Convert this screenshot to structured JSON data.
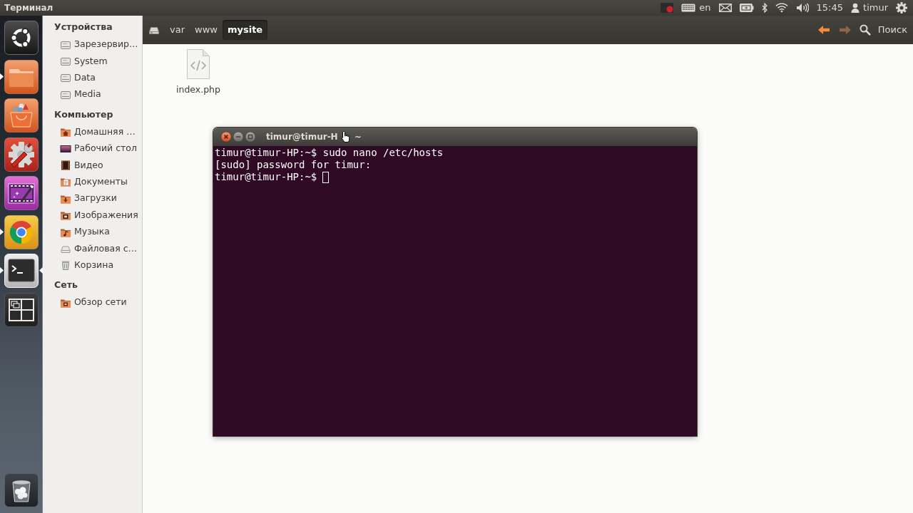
{
  "top_panel": {
    "app_title": "Терминал",
    "keyboard_layout": "en",
    "clock": "15:45",
    "user": "timur"
  },
  "launcher": {
    "items": [
      {
        "kind": "dash",
        "running": false,
        "focused": false
      },
      {
        "kind": "files",
        "running": true,
        "focused": false
      },
      {
        "kind": "software",
        "running": false,
        "focused": false
      },
      {
        "kind": "settings",
        "running": false,
        "focused": false
      },
      {
        "kind": "video_editor",
        "running": false,
        "focused": false
      },
      {
        "kind": "browser",
        "running": true,
        "focused": false
      },
      {
        "kind": "terminal",
        "running": true,
        "focused": true
      },
      {
        "kind": "workspaces",
        "running": false,
        "focused": false
      }
    ],
    "bottom_items": [
      {
        "kind": "trash",
        "running": false,
        "focused": false
      }
    ]
  },
  "sidebar": {
    "sections": [
      {
        "heading": "Устройства",
        "items": [
          {
            "label": "Зарезервир…",
            "kind": "drive",
            "selected": false
          },
          {
            "label": "System",
            "kind": "drive",
            "selected": false
          },
          {
            "label": "Data",
            "kind": "drive",
            "selected": false
          },
          {
            "label": "Media",
            "kind": "drive",
            "selected": false
          }
        ]
      },
      {
        "heading": "Компьютер",
        "items": [
          {
            "label": "Домашняя …",
            "kind": "home",
            "selected": false
          },
          {
            "label": "Рабочий стол",
            "kind": "desktop",
            "selected": false
          },
          {
            "label": "Видео",
            "kind": "videos",
            "selected": false
          },
          {
            "label": "Документы",
            "kind": "documents",
            "selected": false
          },
          {
            "label": "Загрузки",
            "kind": "downloads",
            "selected": false
          },
          {
            "label": "Изображения",
            "kind": "pictures",
            "selected": false
          },
          {
            "label": "Музыка",
            "kind": "music",
            "selected": false
          },
          {
            "label": "Файловая с…",
            "kind": "filesystem",
            "selected": false
          },
          {
            "label": "Корзина",
            "kind": "trash",
            "selected": false
          }
        ]
      },
      {
        "heading": "Сеть",
        "items": [
          {
            "label": "Обзор сети",
            "kind": "network",
            "selected": false
          }
        ]
      }
    ]
  },
  "toolbar": {
    "path": [
      {
        "kind": "root",
        "selected": false
      },
      {
        "kind": "folder",
        "label": "var",
        "selected": false
      },
      {
        "kind": "folder",
        "label": "www",
        "selected": false
      },
      {
        "kind": "folder",
        "label": "mysite",
        "selected": true
      }
    ],
    "back": {
      "disabled": false
    },
    "forward": {
      "disabled": true
    },
    "search_label": "Поиск"
  },
  "files": [
    {
      "name": "index.php",
      "kind": "code",
      "selected": false
    }
  ],
  "terminal_window": {
    "title": "timur@timur-H",
    "title_end": "~",
    "lines": [
      "timur@timur-HP:~$ sudo nano /etc/hosts",
      "[sudo] password for timur:",
      "timur@timur-HP:~$"
    ]
  }
}
